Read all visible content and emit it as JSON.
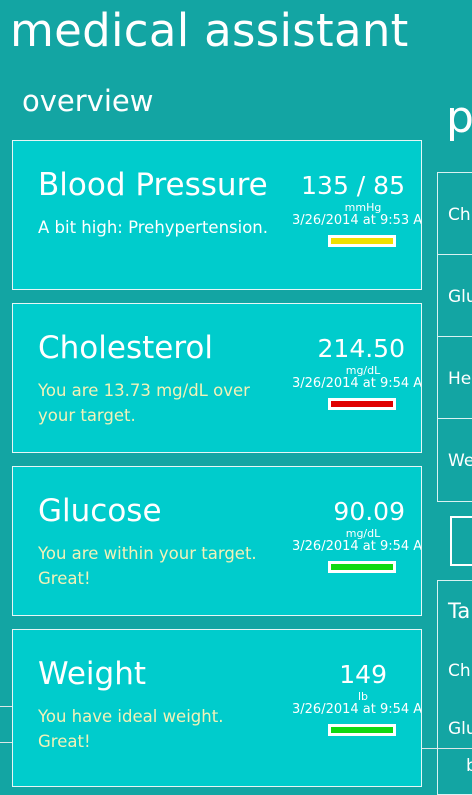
{
  "app": {
    "title": "medical assistant"
  },
  "section": {
    "title": "overview"
  },
  "next_section": {
    "title_fragment": "p"
  },
  "cards": [
    {
      "name": "Blood Pressure",
      "message": "A bit high: Prehypertension.",
      "value": "135 / 85",
      "unit": "mmHg",
      "date": "3/26/2014 at 9:53 AM",
      "status_color": "#f0e000",
      "message_color": "#ffffff"
    },
    {
      "name": "Cholesterol",
      "message": "You are 13.73 mg/dL over your target.",
      "value": "214.50",
      "unit": "mg/dL",
      "date": "3/26/2014 at 9:54 AM",
      "status_color": "#e00000",
      "message_color": "#f2f2b8"
    },
    {
      "name": "Glucose",
      "message": "You are within your target. Great!",
      "value": "90.09",
      "unit": "mg/dL",
      "date": "3/26/2014 at 9:54 AM",
      "status_color": "#11d911",
      "message_color": "#f2f2b8"
    },
    {
      "name": "Weight",
      "message": "You have ideal weight. Great!",
      "value": "149",
      "unit": "lb",
      "date": "3/26/2014 at 9:54 AM",
      "status_color": "#11d911",
      "message_color": "#f2f2b8"
    }
  ],
  "side_list": {
    "items": [
      "Ch",
      "Glu",
      "He",
      "We"
    ]
  },
  "side_targets": {
    "title": "Ta",
    "items": [
      "Ch",
      "Glu"
    ],
    "bottom_fragment": "b"
  }
}
